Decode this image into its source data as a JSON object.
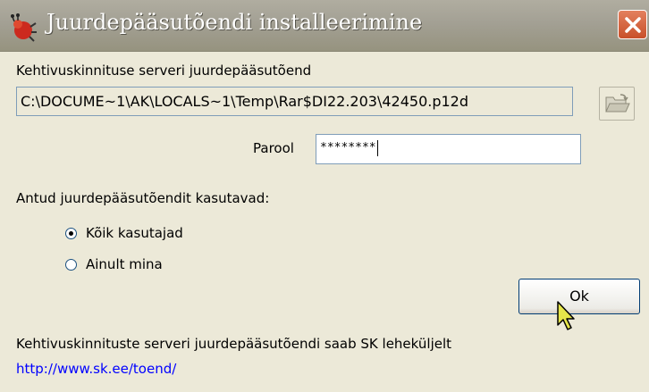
{
  "window": {
    "title": "Juurdepääsutõendi installeerimine"
  },
  "form": {
    "cert_label": "Kehtivuskinnituse serveri juurdepääsutõend",
    "cert_path": "C:\\DOCUME~1\\AK\\LOCALS~1\\Temp\\Rar$DI22.203\\42450.p12d",
    "password_label": "Parool",
    "password_value": "********",
    "users_label": "Antud juurdepääsutõendit kasutavad:",
    "options": [
      {
        "label": "Kõik kasutajad",
        "selected": true
      },
      {
        "label": "Ainult mina",
        "selected": false
      }
    ],
    "ok_label": "Ok"
  },
  "footer": {
    "info_text": "Kehtivuskinnituste serveri juurdepääsutõendi saab SK leheküljelt",
    "link_text": "http://www.sk.ee/toend/"
  },
  "colors": {
    "title_bar": "#A3A094",
    "close_button": "#D4603A",
    "link": "#0000FF",
    "cursor": "#E6E64A"
  },
  "icons": {
    "app": "bug-icon",
    "close": "close-icon",
    "browse": "folder-open-icon",
    "pointer": "mouse-cursor-icon"
  }
}
